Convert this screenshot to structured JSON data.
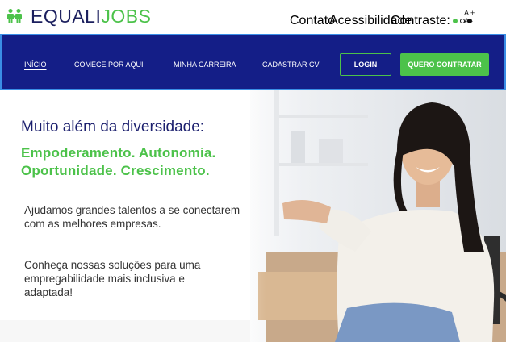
{
  "brand": {
    "name_part1": "EQUALI",
    "name_part2": "JOBS",
    "primary": "#1b1f5e",
    "accent": "#4cc24a",
    "nav_bg": "#141e87"
  },
  "topbar": {
    "contato": "Contato",
    "acessibilidade": "Acessibilidade",
    "contraste_label": "Contraste:",
    "contrast_dots": [
      "#4cc24a",
      "#ffffff",
      "#111111"
    ],
    "font_increase": "A +",
    "font_decrease": "A -"
  },
  "nav": {
    "items": [
      {
        "label": "INÍCIO",
        "active": true
      },
      {
        "label": "COMECE POR AQUI",
        "active": false
      },
      {
        "label": "MINHA CARREIRA",
        "active": false
      },
      {
        "label": "CADASTRAR CV",
        "active": false
      }
    ],
    "login_label": "LOGIN",
    "hire_label": "QUERO CONTRATAR"
  },
  "hero": {
    "title": "Muito além da diversidade:",
    "subtitle_line1": "Empoderamento. Autonomia.",
    "subtitle_line2": "Oportunidade. Crescimento.",
    "paragraph1": "Ajudamos grandes talentos a se conectarem com as melhores empresas.",
    "paragraph2": "Conheça nossas soluções para uma empregabilidade mais inclusiva e adaptada!"
  }
}
